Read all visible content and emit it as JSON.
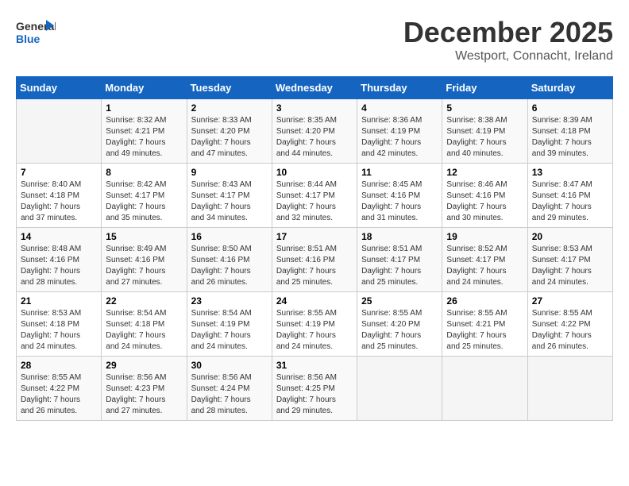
{
  "header": {
    "logo_general": "General",
    "logo_blue": "Blue",
    "month": "December 2025",
    "location": "Westport, Connacht, Ireland"
  },
  "weekdays": [
    "Sunday",
    "Monday",
    "Tuesday",
    "Wednesday",
    "Thursday",
    "Friday",
    "Saturday"
  ],
  "weeks": [
    [
      {
        "day": "",
        "info": ""
      },
      {
        "day": "1",
        "info": "Sunrise: 8:32 AM\nSunset: 4:21 PM\nDaylight: 7 hours\nand 49 minutes."
      },
      {
        "day": "2",
        "info": "Sunrise: 8:33 AM\nSunset: 4:20 PM\nDaylight: 7 hours\nand 47 minutes."
      },
      {
        "day": "3",
        "info": "Sunrise: 8:35 AM\nSunset: 4:20 PM\nDaylight: 7 hours\nand 44 minutes."
      },
      {
        "day": "4",
        "info": "Sunrise: 8:36 AM\nSunset: 4:19 PM\nDaylight: 7 hours\nand 42 minutes."
      },
      {
        "day": "5",
        "info": "Sunrise: 8:38 AM\nSunset: 4:19 PM\nDaylight: 7 hours\nand 40 minutes."
      },
      {
        "day": "6",
        "info": "Sunrise: 8:39 AM\nSunset: 4:18 PM\nDaylight: 7 hours\nand 39 minutes."
      }
    ],
    [
      {
        "day": "7",
        "info": "Sunrise: 8:40 AM\nSunset: 4:18 PM\nDaylight: 7 hours\nand 37 minutes."
      },
      {
        "day": "8",
        "info": "Sunrise: 8:42 AM\nSunset: 4:17 PM\nDaylight: 7 hours\nand 35 minutes."
      },
      {
        "day": "9",
        "info": "Sunrise: 8:43 AM\nSunset: 4:17 PM\nDaylight: 7 hours\nand 34 minutes."
      },
      {
        "day": "10",
        "info": "Sunrise: 8:44 AM\nSunset: 4:17 PM\nDaylight: 7 hours\nand 32 minutes."
      },
      {
        "day": "11",
        "info": "Sunrise: 8:45 AM\nSunset: 4:16 PM\nDaylight: 7 hours\nand 31 minutes."
      },
      {
        "day": "12",
        "info": "Sunrise: 8:46 AM\nSunset: 4:16 PM\nDaylight: 7 hours\nand 30 minutes."
      },
      {
        "day": "13",
        "info": "Sunrise: 8:47 AM\nSunset: 4:16 PM\nDaylight: 7 hours\nand 29 minutes."
      }
    ],
    [
      {
        "day": "14",
        "info": "Sunrise: 8:48 AM\nSunset: 4:16 PM\nDaylight: 7 hours\nand 28 minutes."
      },
      {
        "day": "15",
        "info": "Sunrise: 8:49 AM\nSunset: 4:16 PM\nDaylight: 7 hours\nand 27 minutes."
      },
      {
        "day": "16",
        "info": "Sunrise: 8:50 AM\nSunset: 4:16 PM\nDaylight: 7 hours\nand 26 minutes."
      },
      {
        "day": "17",
        "info": "Sunrise: 8:51 AM\nSunset: 4:16 PM\nDaylight: 7 hours\nand 25 minutes."
      },
      {
        "day": "18",
        "info": "Sunrise: 8:51 AM\nSunset: 4:17 PM\nDaylight: 7 hours\nand 25 minutes."
      },
      {
        "day": "19",
        "info": "Sunrise: 8:52 AM\nSunset: 4:17 PM\nDaylight: 7 hours\nand 24 minutes."
      },
      {
        "day": "20",
        "info": "Sunrise: 8:53 AM\nSunset: 4:17 PM\nDaylight: 7 hours\nand 24 minutes."
      }
    ],
    [
      {
        "day": "21",
        "info": "Sunrise: 8:53 AM\nSunset: 4:18 PM\nDaylight: 7 hours\nand 24 minutes."
      },
      {
        "day": "22",
        "info": "Sunrise: 8:54 AM\nSunset: 4:18 PM\nDaylight: 7 hours\nand 24 minutes."
      },
      {
        "day": "23",
        "info": "Sunrise: 8:54 AM\nSunset: 4:19 PM\nDaylight: 7 hours\nand 24 minutes."
      },
      {
        "day": "24",
        "info": "Sunrise: 8:55 AM\nSunset: 4:19 PM\nDaylight: 7 hours\nand 24 minutes."
      },
      {
        "day": "25",
        "info": "Sunrise: 8:55 AM\nSunset: 4:20 PM\nDaylight: 7 hours\nand 25 minutes."
      },
      {
        "day": "26",
        "info": "Sunrise: 8:55 AM\nSunset: 4:21 PM\nDaylight: 7 hours\nand 25 minutes."
      },
      {
        "day": "27",
        "info": "Sunrise: 8:55 AM\nSunset: 4:22 PM\nDaylight: 7 hours\nand 26 minutes."
      }
    ],
    [
      {
        "day": "28",
        "info": "Sunrise: 8:55 AM\nSunset: 4:22 PM\nDaylight: 7 hours\nand 26 minutes."
      },
      {
        "day": "29",
        "info": "Sunrise: 8:56 AM\nSunset: 4:23 PM\nDaylight: 7 hours\nand 27 minutes."
      },
      {
        "day": "30",
        "info": "Sunrise: 8:56 AM\nSunset: 4:24 PM\nDaylight: 7 hours\nand 28 minutes."
      },
      {
        "day": "31",
        "info": "Sunrise: 8:56 AM\nSunset: 4:25 PM\nDaylight: 7 hours\nand 29 minutes."
      },
      {
        "day": "",
        "info": ""
      },
      {
        "day": "",
        "info": ""
      },
      {
        "day": "",
        "info": ""
      }
    ]
  ]
}
